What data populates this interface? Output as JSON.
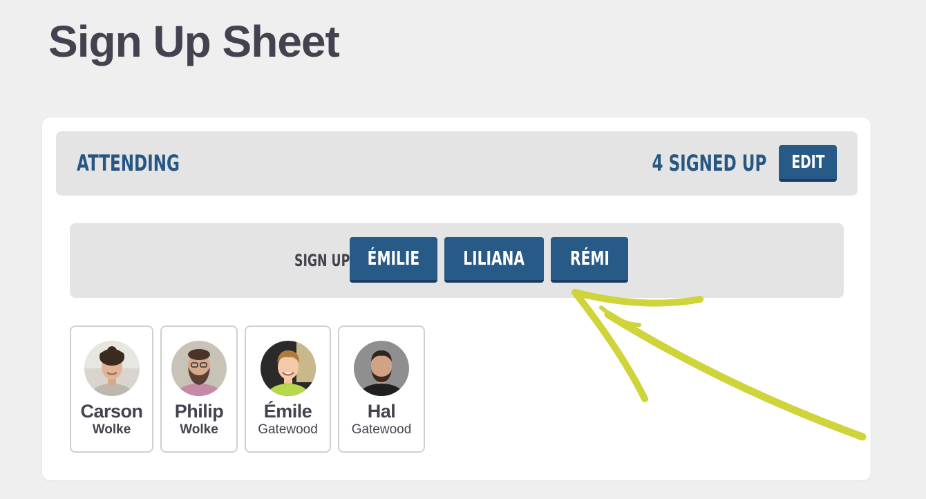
{
  "page": {
    "title": "Sign Up Sheet"
  },
  "header": {
    "title": "ATTENDING",
    "signed_count": "4 SIGNED UP",
    "edit_label": "EDIT"
  },
  "signup": {
    "label": "SIGN UP:",
    "buttons": [
      "ÉMILIE",
      "LILIANA",
      "RÉMI"
    ]
  },
  "attendees": [
    {
      "first": "Carson",
      "last": "Wolke"
    },
    {
      "first": "Philip",
      "last": "Wolke"
    },
    {
      "first": "Émile",
      "last": "Gatewood"
    },
    {
      "first": "Hal",
      "last": "Gatewood"
    }
  ],
  "colors": {
    "accent": "#285a87",
    "title": "#43424f",
    "panel": "#e4e4e4",
    "annotation_arrow": "#cfd43a"
  }
}
